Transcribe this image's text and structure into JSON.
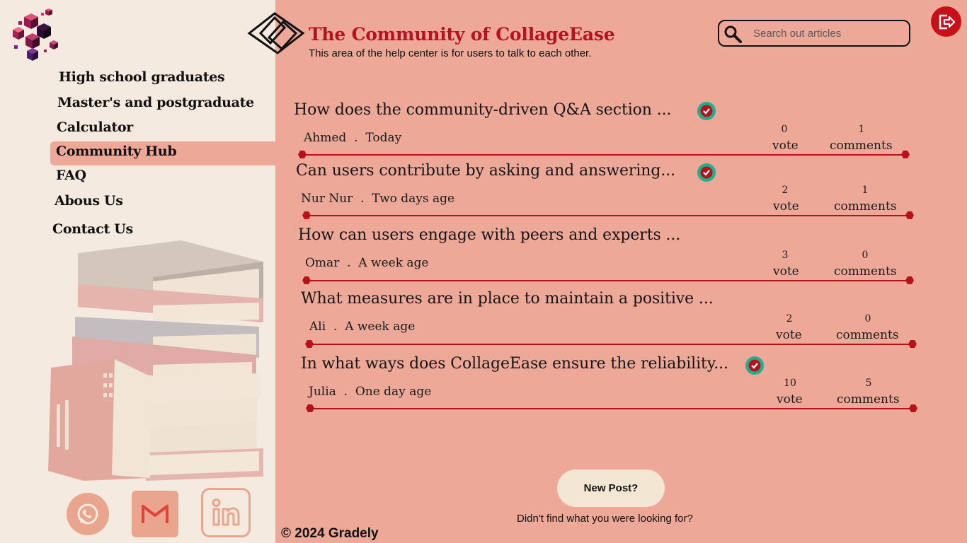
{
  "sidebar": {
    "items": [
      {
        "label": "High school graduates"
      },
      {
        "label": "Master's and postgraduate"
      },
      {
        "label": "Calculator"
      },
      {
        "label": "Community Hub",
        "active": true
      },
      {
        "label": "FAQ"
      },
      {
        "label": "Abous Us"
      },
      {
        "label": "Contact Us"
      }
    ],
    "social": [
      "whatsapp-icon",
      "gmail-icon",
      "linkedin-icon"
    ]
  },
  "header": {
    "title": "The Community of CollageEase",
    "subtitle": "This area of the help center is for users to talk to each other."
  },
  "search": {
    "placeholder": "Search out articles",
    "value": ""
  },
  "posts": [
    {
      "title": "How does the community-driven Q&A section ...",
      "author": "Ahmed",
      "sep": ".",
      "time": "Today",
      "votes": "0",
      "vote_label": "vote",
      "comments": "1",
      "comments_label": "comments",
      "verified": true
    },
    {
      "title": "Can users contribute by asking and answering...",
      "author": "Nur Nur",
      "sep": ".",
      "time": "Two days age",
      "votes": "2",
      "vote_label": "vote",
      "comments": "1",
      "comments_label": "comments",
      "verified": true
    },
    {
      "title": "How can users engage with peers and experts ...",
      "author": "Omar",
      "sep": ".",
      "time": "A week age",
      "votes": "3",
      "vote_label": "vote",
      "comments": "0",
      "comments_label": "comments",
      "verified": false
    },
    {
      "title": "What measures are in place to maintain a positive ...",
      "author": "Ali",
      "sep": ".",
      "time": "A week age",
      "votes": "2",
      "vote_label": "vote",
      "comments": "0",
      "comments_label": "comments",
      "verified": false
    },
    {
      "title": "In what ways does CollageEase ensure the reliability...",
      "author": "Julia",
      "sep": ".",
      "time": "One day age",
      "votes": "10",
      "vote_label": "vote",
      "comments": "5",
      "comments_label": "comments",
      "verified": true
    }
  ],
  "actions": {
    "new_post": "New Post?",
    "help_text": "Didn't find what you were looking for?"
  },
  "footer": {
    "text": "© 2024 Gradely"
  },
  "colors": {
    "accent": "#b5121b",
    "page_bg": "#eda898",
    "sidebar_bg": "#f5eadf",
    "button_bg": "#f3e7d3",
    "verified_badge": "#1fae8e"
  }
}
